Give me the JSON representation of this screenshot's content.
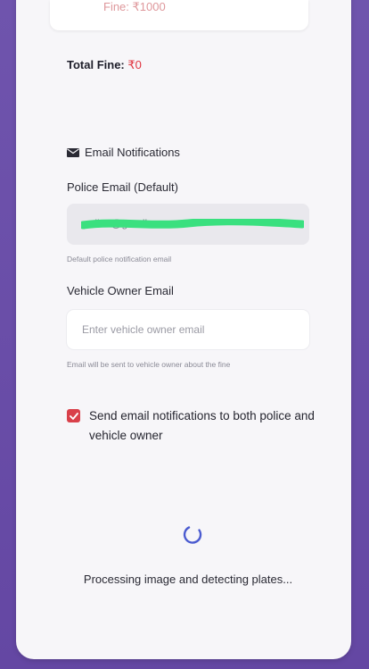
{
  "fine_item": {
    "partial_text": "Fine: ₹1000"
  },
  "total_fine": {
    "label": "Total Fine: ",
    "amount": "₹0"
  },
  "email_section": {
    "icon": "envelope-icon",
    "heading": "Email Notifications"
  },
  "police_email": {
    "label": "Police Email (Default)",
    "value": "police@gmail.com",
    "hint": "Default police notification email"
  },
  "owner_email": {
    "label": "Vehicle Owner Email",
    "placeholder": "Enter vehicle owner email",
    "value": "",
    "hint": "Email will be sent to vehicle owner about the fine"
  },
  "notify_both": {
    "checked": true,
    "label": "Send email notifications to both police and vehicle owner"
  },
  "status": {
    "icon": "loading-spinner-icon",
    "text": "Processing image and detecting plates..."
  },
  "colors": {
    "accent": "#e0343f",
    "frame": "#6a4fa8",
    "spinner": "#4b5bd0",
    "redaction": "#3ae07f"
  }
}
